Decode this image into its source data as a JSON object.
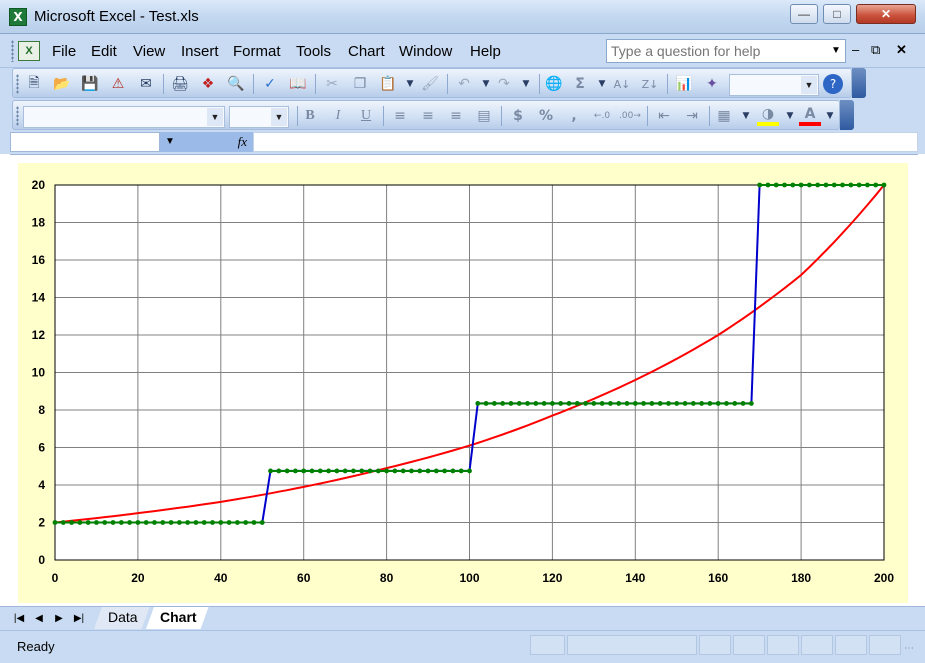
{
  "window": {
    "title": "Microsoft Excel - Test.xls",
    "app_icon": "X"
  },
  "menu": {
    "items": [
      "File",
      "Edit",
      "View",
      "Insert",
      "Format",
      "Tools",
      "Chart",
      "Window",
      "Help"
    ],
    "help_placeholder": "Type a question for help"
  },
  "toolbar_standard": {
    "icons": [
      "new-icon",
      "open-icon",
      "save-icon",
      "permission-icon",
      "email-icon",
      "print-icon",
      "research-icon",
      "print-preview-icon",
      "spelling-icon",
      "research-book-icon",
      "cut-icon",
      "copy-icon",
      "paste-icon",
      "format-painter-icon",
      "undo-icon",
      "redo-icon",
      "hyperlink-icon",
      "autosum-icon",
      "sort-ascending-icon",
      "sort-descending-icon",
      "chart-wizard-icon",
      "drawing-icon",
      "help-icon"
    ]
  },
  "toolbar_formatting": {
    "bold": "B",
    "italic": "I",
    "underline": "U",
    "currency": "$",
    "percent": "%",
    "comma": ","
  },
  "formula_bar": {
    "fx": "fx"
  },
  "sheet_tabs": [
    "Data",
    "Chart"
  ],
  "active_tab": "Chart",
  "status": {
    "text": "Ready"
  },
  "colors": {
    "chart_area": "#ffffcc",
    "series_red": "#ff0000",
    "series_blue": "#0000cc",
    "series_green_markers": "#008000"
  },
  "chart_data": {
    "type": "line",
    "title": "",
    "xlabel": "",
    "ylabel": "",
    "xlim": [
      0,
      200
    ],
    "ylim": [
      0,
      20
    ],
    "x_ticks": [
      0,
      20,
      40,
      60,
      80,
      100,
      120,
      140,
      160,
      180,
      200
    ],
    "y_ticks": [
      0,
      2,
      4,
      6,
      8,
      10,
      12,
      14,
      16,
      18,
      20
    ],
    "grid": true,
    "legend": "none",
    "series": [
      {
        "style": "red-curve",
        "x": [
          0,
          20,
          40,
          60,
          80,
          100,
          120,
          140,
          160,
          180,
          200
        ],
        "y": [
          2.0,
          2.5,
          3.1,
          3.9,
          4.9,
          6.1,
          7.7,
          9.6,
          12.0,
          15.2,
          20.0
        ]
      },
      {
        "style": "blue-step",
        "x": [
          0,
          50,
          52,
          100,
          102,
          168,
          170,
          200
        ],
        "y": [
          2.0,
          2.0,
          4.75,
          4.75,
          8.35,
          8.35,
          20.0,
          20.0
        ]
      },
      {
        "style": "green-markers",
        "segments": [
          {
            "x_start": 0,
            "x_end": 50,
            "y": 2.0
          },
          {
            "x_start": 52,
            "x_end": 100,
            "y": 4.75
          },
          {
            "x_start": 102,
            "x_end": 168,
            "y": 8.35
          },
          {
            "x_start": 170,
            "x_end": 200,
            "y": 20.0
          }
        ],
        "step": 2
      }
    ]
  }
}
